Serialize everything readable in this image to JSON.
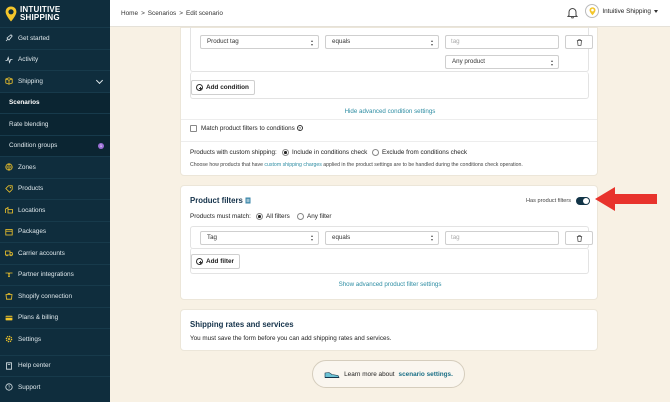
{
  "brand": {
    "line1": "INTUITIVE",
    "line2": "SHIPPING",
    "color": "#f3c62b"
  },
  "sidebar": {
    "items": [
      {
        "label": "Get started",
        "icon": "rocket-icon"
      },
      {
        "label": "Activity",
        "icon": "activity-icon"
      },
      {
        "label": "Shipping",
        "icon": "shipping-icon"
      },
      {
        "label": "Scenarios",
        "icon": ""
      },
      {
        "label": "Rate blending",
        "icon": ""
      },
      {
        "label": "Condition groups",
        "icon": ""
      },
      {
        "label": "Zones",
        "icon": "zones-icon"
      },
      {
        "label": "Products",
        "icon": "products-icon"
      },
      {
        "label": "Locations",
        "icon": "locations-icon"
      },
      {
        "label": "Packages",
        "icon": "packages-icon"
      },
      {
        "label": "Carrier accounts",
        "icon": "carrier-icon"
      },
      {
        "label": "Partner integrations",
        "icon": "partner-icon"
      },
      {
        "label": "Shopify connection",
        "icon": "shopify-icon"
      },
      {
        "label": "Plans & billing",
        "icon": "billing-icon"
      },
      {
        "label": "Settings",
        "icon": "gear-icon"
      },
      {
        "label": "Help center",
        "icon": "help-icon"
      },
      {
        "label": "Support",
        "icon": "support-icon"
      }
    ],
    "condition_groups_badge": "1"
  },
  "topbar": {
    "breadcrumb": [
      "Home",
      ">",
      "Scenarios",
      ">",
      "Edit scenario"
    ],
    "user_name": "Intuitive Shipping"
  },
  "conditions_card": {
    "row_field": "Product tag",
    "row_operator": "equals",
    "row_value_placeholder": "tag",
    "row_any": "Any product",
    "add_condition": "Add condition",
    "hide_advanced": "Hide advanced condition settings",
    "match_filters_label": "Match product filters to conditions",
    "custom_shipping_label": "Products with custom shipping:",
    "include_label": "Include in conditions check",
    "exclude_label": "Exclude from conditions check",
    "help_text_prefix": "Choose how products that have",
    "help_text_link": "custom shipping charges",
    "help_text_suffix": "applied in the product settings are to be handled during the conditions check operation."
  },
  "filters_card": {
    "title": "Product filters",
    "toggle_label": "Has product filters",
    "match_label": "Products must match:",
    "all_filters": "All filters",
    "any_filter": "Any filter",
    "row_field": "Tag",
    "row_operator": "equals",
    "row_value_placeholder": "tag",
    "add_filter": "Add filter",
    "show_advanced": "Show advanced product filter settings"
  },
  "rates_card": {
    "title": "Shipping rates and services",
    "message": "You must save the form before you can add shipping rates and services."
  },
  "learn_more": {
    "prefix": "Learn more about",
    "link": "scenario settings."
  },
  "colors": {
    "sidebar": "#0f2d3d",
    "accent": "#2e8da3",
    "arrow": "#e8332c",
    "background": "#f8f1e4"
  }
}
